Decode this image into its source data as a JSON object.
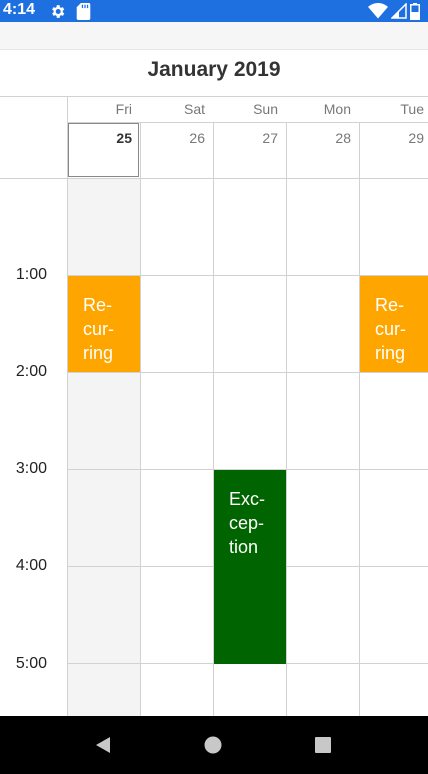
{
  "status_bar": {
    "time": "4:14",
    "icons": [
      "gear-icon",
      "sd-card-icon",
      "wifi-icon",
      "signal-icon",
      "battery-icon"
    ],
    "color": "#1e6fe0"
  },
  "calendar": {
    "title": "January 2019",
    "days": [
      {
        "name": "Fri",
        "number": "25",
        "today": true
      },
      {
        "name": "Sat",
        "number": "26",
        "today": false
      },
      {
        "name": "Sun",
        "number": "27",
        "today": false
      },
      {
        "name": "Mon",
        "number": "28",
        "today": false
      },
      {
        "name": "Tue",
        "number": "29",
        "today": false
      }
    ],
    "hours": [
      "1:00",
      "2:00",
      "3:00",
      "4:00",
      "5:00"
    ],
    "events": [
      {
        "label": "Re-\ncur-\nring",
        "day": "Fri",
        "start": "1:00",
        "end": "2:00",
        "color": "#ffa500"
      },
      {
        "label": "Exception",
        "text_lines": "Exc-\ncep-\ntion",
        "day": "Sun",
        "start": "3:00",
        "end": "5:00",
        "color": "#006400"
      },
      {
        "label": "Re-\ncur-\nring",
        "day": "Tue",
        "start": "1:00",
        "end": "2:00",
        "color": "#ffa500"
      }
    ]
  },
  "nav_bar": {
    "buttons": [
      "back-icon",
      "home-icon",
      "recents-icon"
    ]
  }
}
